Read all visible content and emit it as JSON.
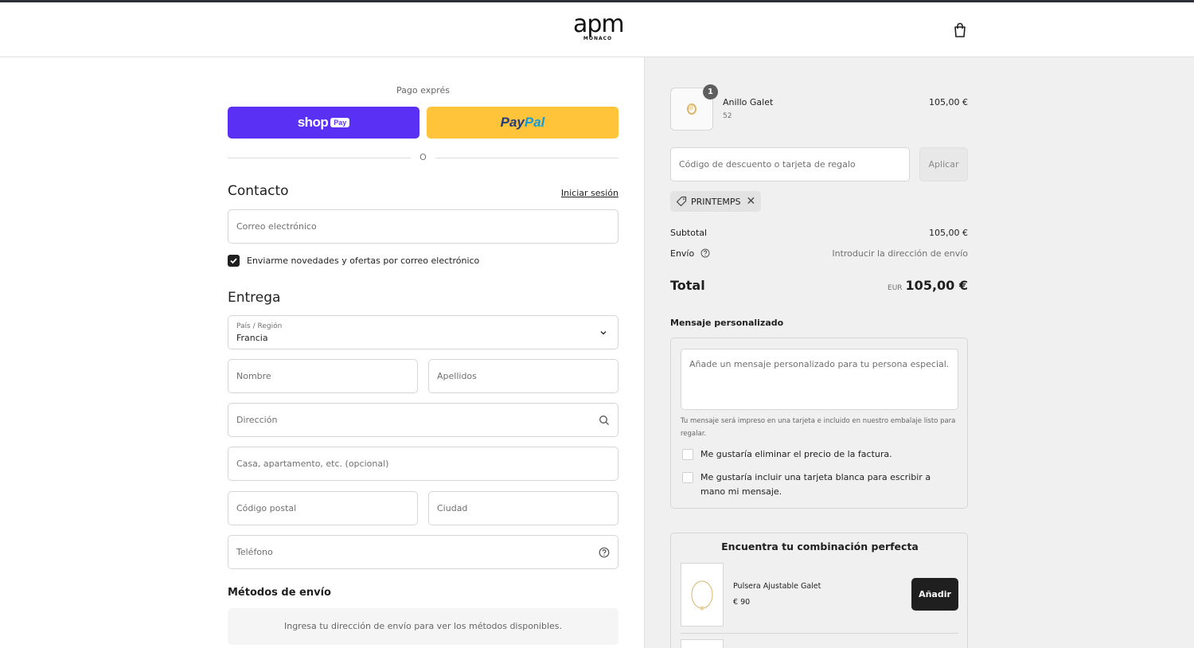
{
  "header": {
    "logo_main": "apm",
    "logo_sub": "MONACO"
  },
  "express": {
    "title": "Pago exprés",
    "shop_label": "shop",
    "shop_pay_badge": "Pay",
    "paypal_part1": "Pay",
    "paypal_part2": "Pal",
    "or_label": "O"
  },
  "contact": {
    "title": "Contacto",
    "login_link": "Iniciar sesión",
    "email_placeholder": "Correo electrónico",
    "newsletter_label": "Enviarme novedades y ofertas por correo electrónico",
    "newsletter_checked": true
  },
  "delivery": {
    "title": "Entrega",
    "country_label": "País / Región",
    "country_value": "Francia",
    "first_name_placeholder": "Nombre",
    "last_name_placeholder": "Apellidos",
    "address_placeholder": "Dirección",
    "apartment_placeholder": "Casa, apartamento, etc. (opcional)",
    "postal_code_placeholder": "Código postal",
    "city_placeholder": "Ciudad",
    "phone_placeholder": "Teléfono"
  },
  "shipping_methods": {
    "title": "Métodos de envío",
    "empty_message": "Ingresa tu dirección de envío para ver los métodos disponibles."
  },
  "order": {
    "item": {
      "name": "Anillo Galet",
      "variant": "52",
      "quantity": "1",
      "price": "105,00 €"
    },
    "discount_placeholder": "Código de descuento o tarjeta de regalo",
    "apply_label": "Aplicar",
    "applied_code": "PRINTEMPS",
    "subtotal_label": "Subtotal",
    "subtotal_value": "105,00 €",
    "shipping_label": "Envío",
    "shipping_value": "Introducir la dirección de envío",
    "total_label": "Total",
    "currency": "EUR",
    "total_value": "105,00 €"
  },
  "message": {
    "title": "Mensaje personalizado",
    "placeholder": "Añade un mensaje personalizado para tu persona especial.",
    "note": "Tu mensaje será impreso en una tarjeta e incluido en nuestro embalaje listo para regalar.",
    "option_remove_price": "Me gustaría eliminar el precio de la factura.",
    "option_blank_card": "Me gustaría incluir una tarjeta blanca para escribir a mano mi mensaje."
  },
  "upsell": {
    "title": "Encuentra tu combinación perfecta",
    "product_name": "Pulsera Ajustable Galet",
    "product_price": "€ 90",
    "add_label": "Añadir"
  },
  "colors": {
    "shop_pay": "#5a31f4",
    "paypal": "#ffc439",
    "sidebar_bg": "#f0f0f0",
    "dark": "#1f1f1f"
  }
}
